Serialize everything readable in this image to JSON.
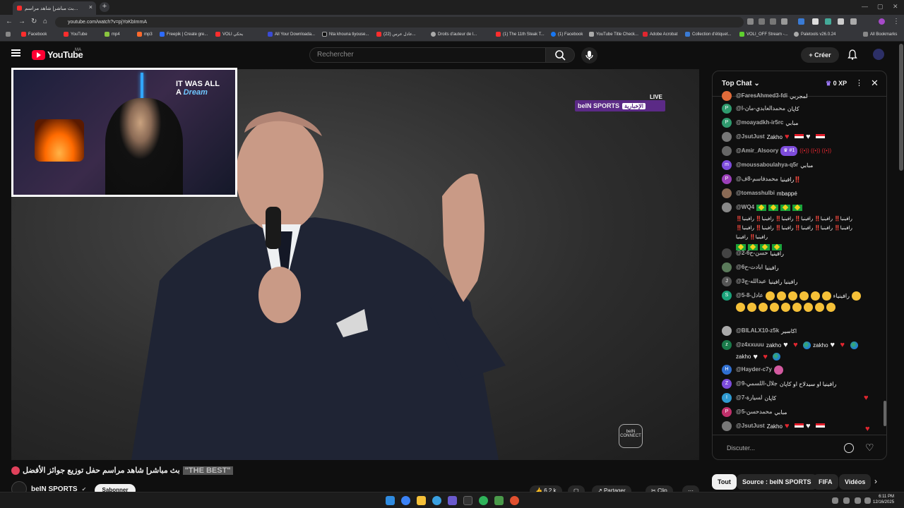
{
  "browser": {
    "tab_title": "بث مباشر| شاهد مراسم...",
    "url": "youtube.com/watch?v=pjYoKbImmA",
    "bookmarks": [
      "Facebook",
      "YouTube",
      "mp4",
      "mp3",
      "Freepik | Create gre...",
      "VOLI يحكي",
      "All Your Downloada...",
      "Nta khouna tiyouse...",
      "(22) عادل عرس...",
      "Droits d'auteur de l...",
      "(1) The 11th Steak T...",
      "(1) Facebook",
      "YouTube Title Check...",
      "Adobe Acrobat",
      "Collection d'étiquet...",
      "VOLI_OFF Stream -...",
      "Paletools v26.0.24",
      "All Bookmarks"
    ]
  },
  "youtube": {
    "logo": "YouTube",
    "country": "MA",
    "search_placeholder": "Rechercher",
    "create_label": "Créer"
  },
  "video": {
    "live_label": "LIVE",
    "network": "beIN SPORTS",
    "network_ar": "الإخبارية",
    "connect_label": "beIN CONNECT",
    "overlay_text_1": "IT WAS ALL",
    "overlay_text_2": "A",
    "overlay_text_3": "Dream",
    "title": "بث مباشر| شاهد مراسم حفل توزيع جوائز الأفضل",
    "title_highlight": "\"THE BEST\"",
    "channel": "beIN SPORTS",
    "subscribe": "Sabonner",
    "likes": "6,2 k",
    "share": "Partager",
    "clip": "Clip"
  },
  "chat": {
    "header": "Top Chat",
    "xp": "0 XP",
    "placeholder": "Discuter...",
    "messages": [
      {
        "user": "@FaresAhmed3-fdi",
        "text": "لمجربي",
        "color": "#e06b3a"
      },
      {
        "user": "@محمدالعابدي-مان-ا",
        "text": "كاپان",
        "color": "#2f9a6e"
      },
      {
        "user": "@moayadkh-ir5rc",
        "text": "مبابي",
        "color": "#2f9a6e"
      },
      {
        "user": "@JsutJust",
        "text": "Zakho",
        "color": "#888"
      },
      {
        "user": "@Amir_Alsoory",
        "text": "#1",
        "color": "#888"
      },
      {
        "user": "@moussaboulahya-q5r",
        "text": "مبابي",
        "color": "#7d4cdb"
      },
      {
        "user": "@محمدفاسم-8ف",
        "text": "رافينيا‼️",
        "color": "#9b3fb8"
      },
      {
        "user": "@tomasshulbi",
        "text": "mbappé",
        "color": "#888"
      },
      {
        "user": "@WQ4",
        "text": "رافينيا‼️ رافينيا‼️ رافينيا‼️ رافينيا‼️ رافينيا‼️ رافينيا‼️ رافينيا‼️ رافينيا‼️ رافينيا‼️ رافينيا‼️ رافينيا‼️ رافينيا‼️ رافينيا‼️ رافينيا",
        "color": "#888"
      },
      {
        "user": "@حسن-ح6-2",
        "text": "رافينيا",
        "color": "#888"
      },
      {
        "user": "@ابادت-ح6",
        "text": "رافينيا",
        "color": "#888"
      },
      {
        "user": "@عبدالله-ج3",
        "text": "رافينيا رافينيا",
        "color": "#555"
      },
      {
        "user": "@عادل-8-5",
        "text": "رافينياء",
        "color": "#1aa37a"
      },
      {
        "user": "@BILALX10-z5k",
        "text": "اكاسير",
        "color": "#888"
      },
      {
        "user": "@z4xxuuu",
        "text": "zakho",
        "color": "#1a7a4a"
      },
      {
        "user": "@Hayder-c7y",
        "text": "",
        "color": "#2f6fd1"
      },
      {
        "user": "@جلال-اللسمي-9",
        "text": "رافينيا او سيدلاح او كاپان",
        "color": "#7d4cdb"
      },
      {
        "user": "@لسيارة-7",
        "text": "كاپان",
        "color": "#2f9ad1"
      },
      {
        "user": "@محمدحسن-5",
        "text": "مبابي",
        "color": "#c0306b"
      },
      {
        "user": "@JsutJust",
        "text": "Zakho",
        "color": "#888"
      }
    ]
  },
  "chips": [
    "Tout",
    "Source : beIN SPORTS",
    "FIFA",
    "Vidéos"
  ],
  "taskbar": {
    "time": "6:11 PM",
    "date": "12/16/2025"
  }
}
